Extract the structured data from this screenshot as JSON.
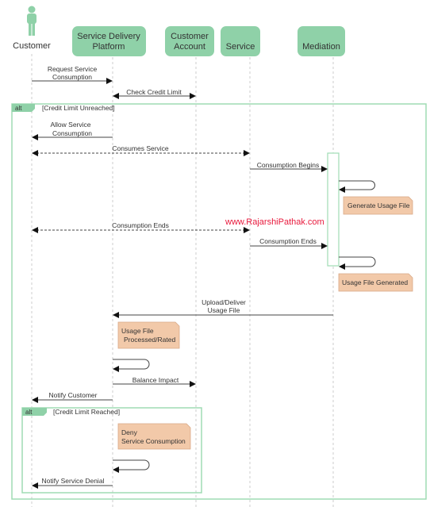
{
  "participants": {
    "customer": "Customer",
    "sdp": [
      "Service Delivery",
      "Platform"
    ],
    "account": [
      "Customer",
      "Account"
    ],
    "service": "Service",
    "mediation": "Mediation"
  },
  "frames": {
    "outer": {
      "tag": "alt",
      "guard": "[Credit Limit Unreached]"
    },
    "inner": {
      "tag": "alt",
      "guard": "[Credit Limit Reached]"
    }
  },
  "messages": {
    "request": [
      "Request Service",
      "Consumption"
    ],
    "check_credit": "Check Credit Limit",
    "allow": [
      "Allow Service",
      "Consumption"
    ],
    "consumes": "Consumes Service",
    "begins": "Consumption Begins",
    "ends_customer": "Consumption Ends",
    "ends_mediation": "Consumption Ends",
    "upload": [
      "Upload/Deliver",
      "Usage File"
    ],
    "balance": "Balance Impact",
    "notify_customer": "Notify Customer",
    "notify_denial": "Notify Service Denial"
  },
  "notes": {
    "generate": "Generate Usage File",
    "generated": "Usage File Generated",
    "processed": [
      "Usage File",
      "Processed/Rated"
    ],
    "deny": [
      "Deny",
      "Service Consumption"
    ]
  },
  "watermark": "www.RajarshiPathak.com",
  "colors": {
    "participant": "#8fd1a8",
    "frame": "#9fdcb4",
    "note": "#f2c9a9",
    "watermark": "#e8193c"
  }
}
